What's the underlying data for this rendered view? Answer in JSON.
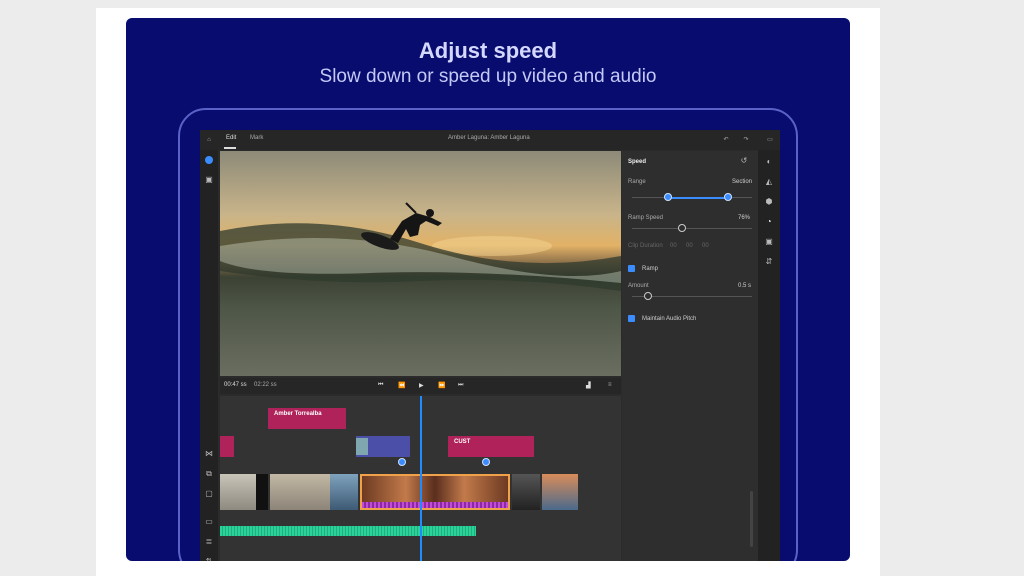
{
  "headline": {
    "title": "Adjust speed",
    "subtitle": "Slow down or speed up video and audio"
  },
  "app": {
    "tabs": [
      "Edit",
      "Mark"
    ],
    "project_title": "Amber Laguna: Amber Laguna",
    "transport": {
      "current_time": "00:47 ss",
      "total_time": "02:22 ss"
    },
    "panel": {
      "heading": "Speed",
      "range_label": "Range",
      "range_value": "Section",
      "ramp_speed_label": "Ramp Speed",
      "ramp_speed_value": "76%",
      "clip_duration_label": "Clip Duration",
      "clip_duration_fields": [
        "00",
        "00",
        "00"
      ],
      "ramp_label": "Ramp",
      "ramp_checked": true,
      "amount_label": "Amount",
      "amount_value": "0.5 s",
      "audio_pitch_label": "Maintain Audio Pitch",
      "audio_pitch_checked": true
    },
    "timeline": {
      "title_clip": "Amber Torrealba",
      "overlay_clip": "CUST"
    }
  },
  "colors": {
    "banner": "#070c6e",
    "title_clip": "#b0235a",
    "overlay_clip": "#b0235a",
    "speed_clip": "#4b4fa8",
    "accent": "#3a8cff",
    "audio": "#2bd39a",
    "selection": "#f0a24a"
  }
}
